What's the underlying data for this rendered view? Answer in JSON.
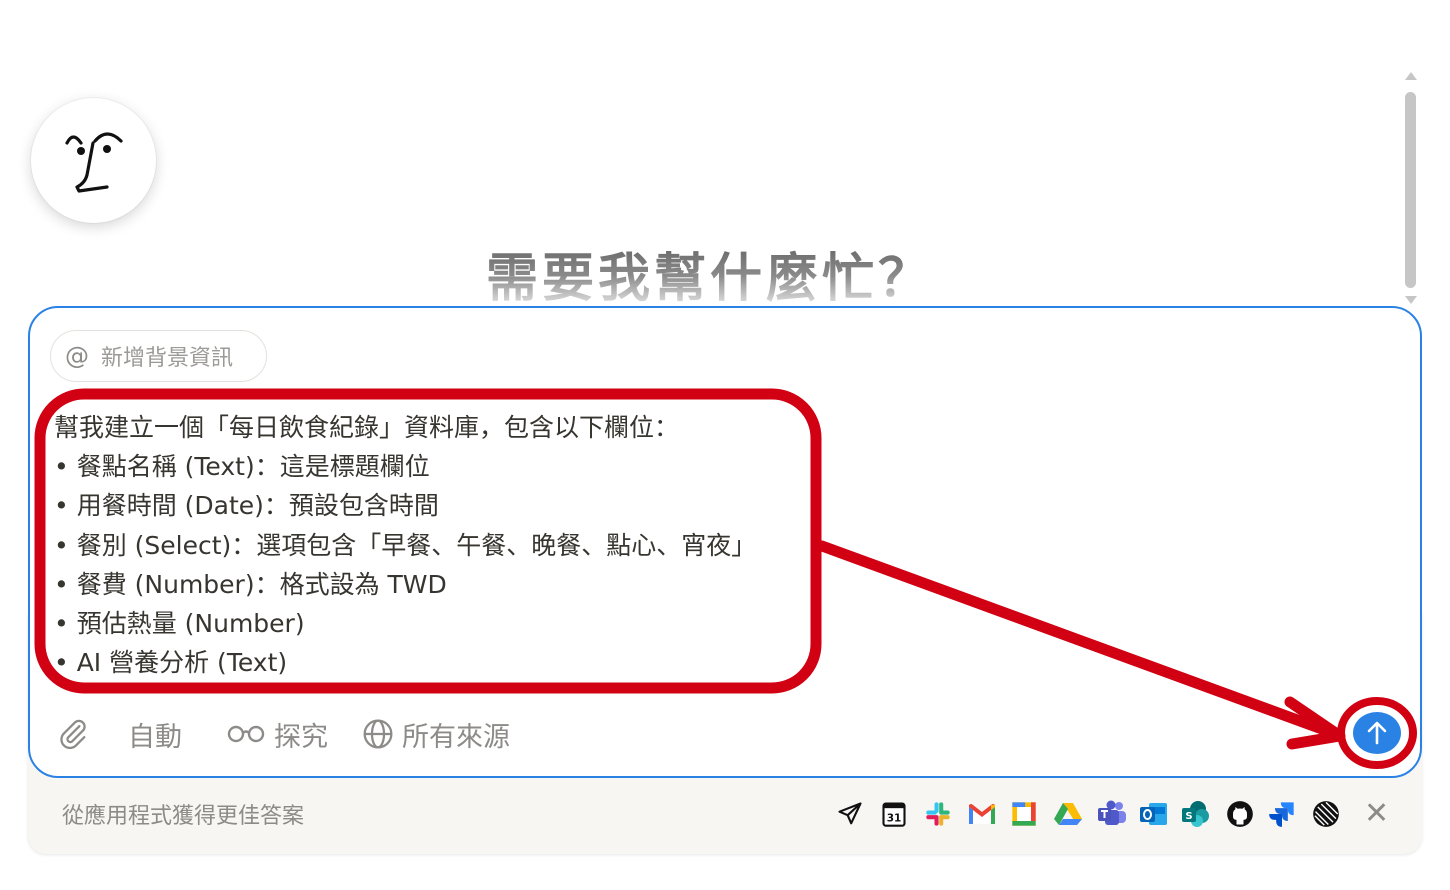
{
  "heading": "需要我幫什麼忙？",
  "context_chip": {
    "icon": "at-icon",
    "label": "新增背景資訊"
  },
  "prompt_lines": [
    "幫我建立一個「每日飲食紀錄」資料庫，包含以下欄位：",
    "• 餐點名稱 (Text)：這是標題欄位",
    "• 用餐時間 (Date)：預設包含時間",
    "• 餐別 (Select)：選項包含「早餐、午餐、晚餐、點心、宵夜」",
    "• 餐費 (Number)：格式設為 TWD",
    "• 預估熱量 (Number)",
    "• AI 營養分析 (Text)"
  ],
  "toolbar": {
    "attach_icon": "paperclip-icon",
    "mode_label": "自動",
    "research_label": "探究",
    "sources_label": "所有來源"
  },
  "footer": {
    "apps_text": "從應用程式獲得更佳答案",
    "apps": [
      "send-icon",
      "calendar-icon",
      "slack-icon",
      "gmail-icon",
      "box-icon",
      "google-drive-icon",
      "teams-icon",
      "outlook-icon",
      "sharepoint-icon",
      "github-icon",
      "jira-icon",
      "linear-icon"
    ],
    "calendar_day": "31",
    "close_icon": "close-icon"
  },
  "colors": {
    "accent": "#2a82e4",
    "annotation": "#d10012",
    "text": "#37352f",
    "muted": "#8c8b88"
  }
}
